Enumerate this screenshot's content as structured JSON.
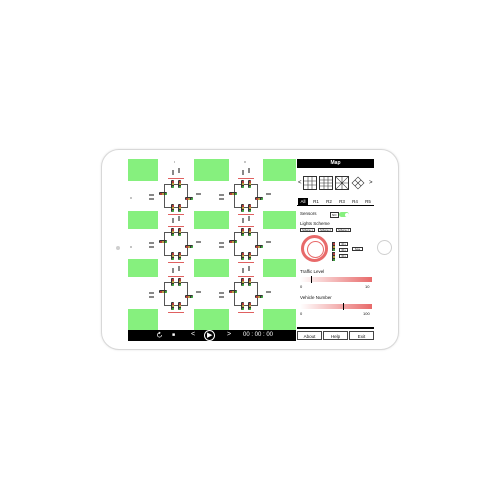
{
  "colors": {
    "grass": "#86f07e",
    "accent": "#e86a6a",
    "bar": "#000000"
  },
  "map": {
    "lane_labels": [
      "I",
      "II",
      "II",
      "II"
    ]
  },
  "controls": {
    "refresh_icon": "refresh-icon",
    "stop_glyph": "■",
    "prev_glyph": "<",
    "play_glyph": "▶",
    "next_glyph": ">",
    "time": "00 : 00 : 00"
  },
  "panel": {
    "title": "Map",
    "prev_arrow": "<",
    "next_arrow": ">",
    "add_glyph": "+",
    "tabs": [
      "All",
      "R1",
      "R2",
      "R3",
      "R4",
      "R5"
    ],
    "sensors_label": "Sensors",
    "sensors_toggle": "NO",
    "lights_scheme_label": "Lights Scheme",
    "scheme_buttons": [
      "Scheme 1",
      "Scheme 2",
      "Scheme 3"
    ],
    "time_buttons": [
      "30 s",
      "30 s",
      "30 s"
    ],
    "save_label": "Save",
    "traffic_level_label": "Traffic Level",
    "traffic_min": "0",
    "traffic_max": "10",
    "traffic_value": 0.15,
    "vehicle_number_label": "Vehicle Number",
    "vehicle_min": "0",
    "vehicle_max": "100",
    "vehicle_value": 0.6,
    "footer": [
      "About",
      "Help",
      "Exit"
    ]
  }
}
